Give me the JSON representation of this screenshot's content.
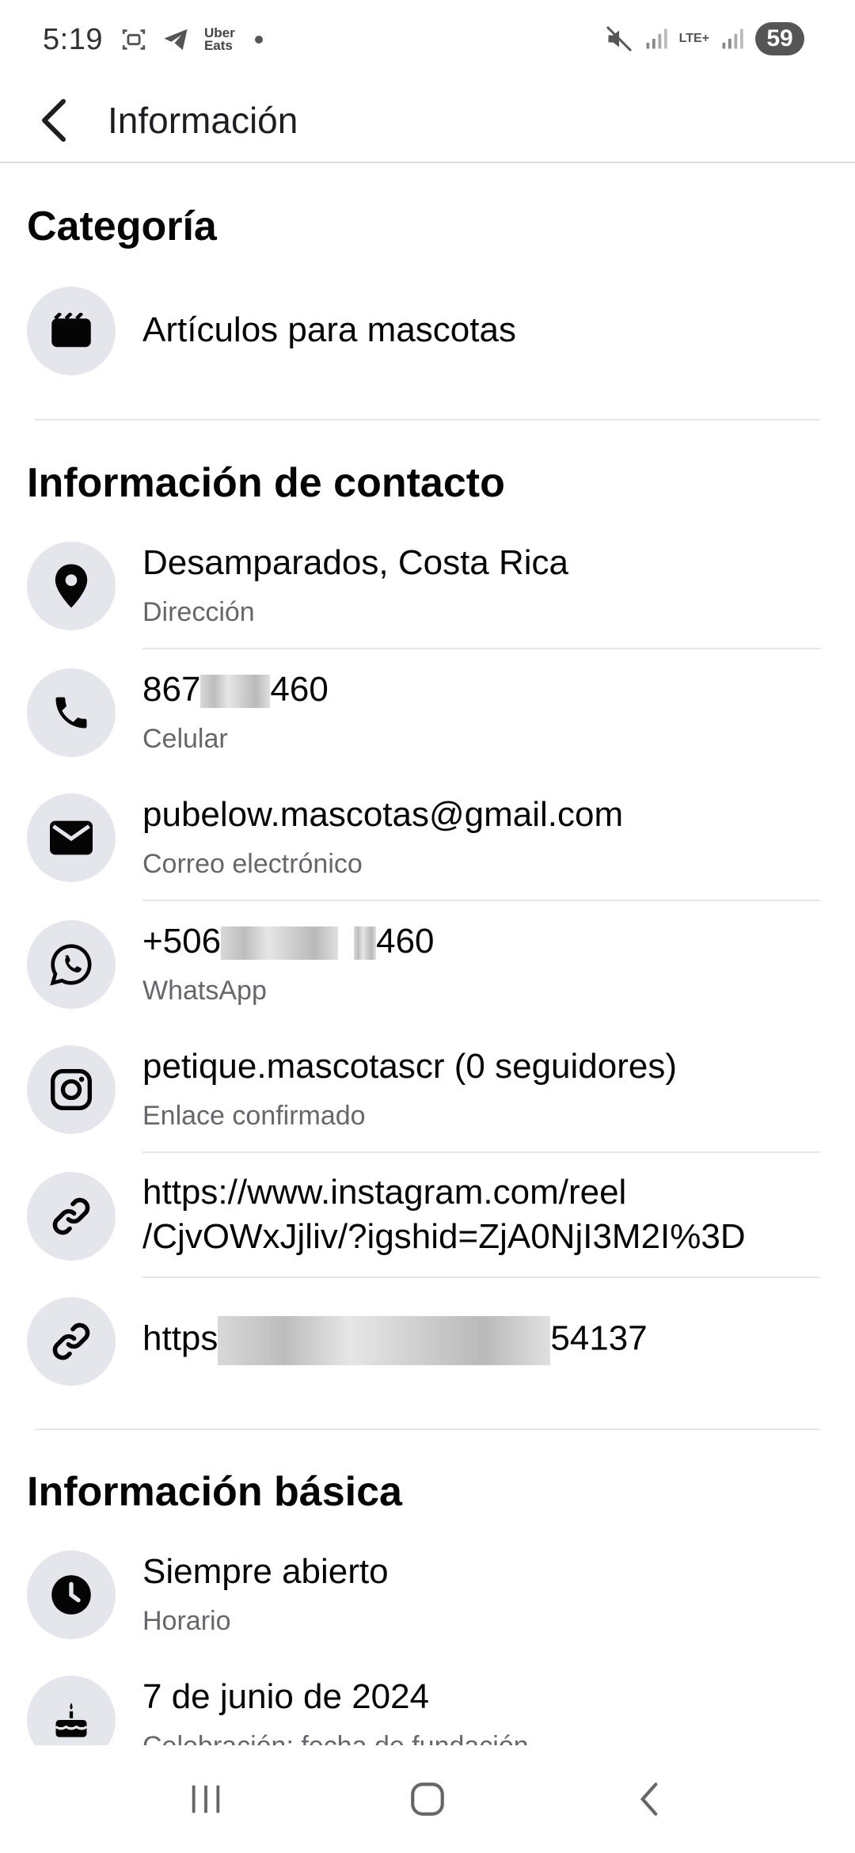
{
  "status_bar": {
    "time": "5:19",
    "uber_eats": "Uber Eats",
    "lte": "LTE+",
    "battery": "59"
  },
  "header": {
    "title": "Información"
  },
  "sections": {
    "categoria": {
      "title": "Categoría",
      "item": {
        "icon": "category-icon",
        "label": "Artículos para mascotas"
      }
    },
    "contacto": {
      "title": "Información de contacto",
      "address": {
        "icon": "location-pin-icon",
        "value": "Desamparados, Costa Rica",
        "label": "Dirección"
      },
      "phone": {
        "icon": "phone-icon",
        "value_start": "867",
        "value_end": "460",
        "label": "Celular"
      },
      "email": {
        "icon": "mail-icon",
        "value": "pubelow.mascotas@gmail.com",
        "label": "Correo electrónico"
      },
      "whatsapp": {
        "icon": "whatsapp-icon",
        "value_start": "+506",
        "value_end": "460",
        "label": "WhatsApp"
      },
      "instagram": {
        "icon": "instagram-icon",
        "value": "petique.mascotascr (0 seguidores)",
        "label": "Enlace confirmado"
      },
      "link1": {
        "icon": "link-icon",
        "line1": "https://www.instagram.com/reel",
        "line2": "/CjvOWxJjliv/?igshid=ZjA0NjI3M2I%3D"
      },
      "link2": {
        "icon": "link-icon",
        "value_start": "https",
        "value_end": "54137"
      }
    },
    "basica": {
      "title": "Información básica",
      "hours": {
        "icon": "clock-icon",
        "value": "Siempre abierto",
        "label": "Horario"
      },
      "founded": {
        "icon": "cake-icon",
        "value": "7 de junio de 2024",
        "label": "Celebración: fecha de fundación"
      }
    }
  },
  "colors": {
    "text_primary": "#050505",
    "text_secondary": "#65676b",
    "icon_bg": "#e4e6eb",
    "divider": "#e4e6eb"
  }
}
